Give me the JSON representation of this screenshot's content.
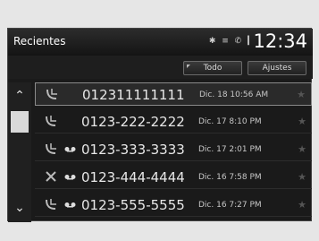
{
  "header": {
    "title": "Recientes",
    "clock": "12:34",
    "status_icons": "✱ ≡ ✆ ▎"
  },
  "tabs": [
    {
      "label": "Todo"
    },
    {
      "label": "Ajustes"
    }
  ],
  "calls": [
    {
      "number": "012311111111",
      "date": "Dic. 18 10:56 AM",
      "type": "incoming",
      "voicemail": false
    },
    {
      "number": "0123-222-2222",
      "date": "Dic. 17 8:10 PM",
      "type": "incoming",
      "voicemail": false
    },
    {
      "number": "0123-333-3333",
      "date": "Dic. 17 2:01 PM",
      "type": "incoming",
      "voicemail": true
    },
    {
      "number": "0123-444-4444",
      "date": "Dic. 16 7:58 PM",
      "type": "missed",
      "voicemail": true
    },
    {
      "number": "0123-555-5555",
      "date": "Dic. 16 7:27 PM",
      "type": "incoming",
      "voicemail": true
    }
  ]
}
